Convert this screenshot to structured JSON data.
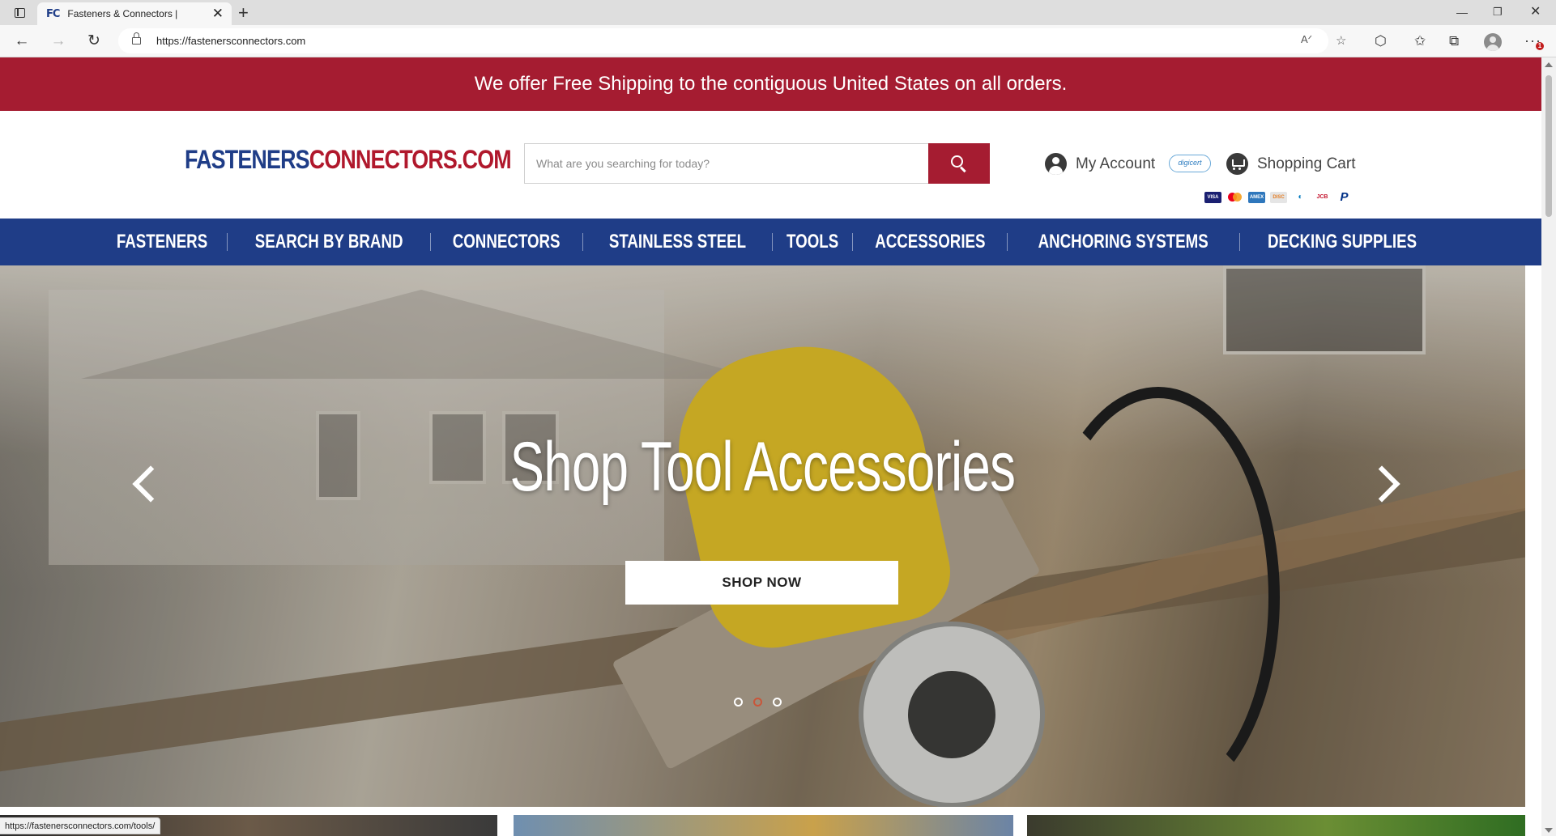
{
  "browser": {
    "tab_title": "Fasteners & Connectors |",
    "favicon_text": "FC",
    "url": "https://fastenersconnectors.com",
    "status_url": "https://fastenersconnectors.com/tools/",
    "notification_count": "1",
    "icons": {
      "back": "arrow-left-icon",
      "forward": "arrow-right-icon",
      "reload": "reload-icon",
      "read_aloud": "read-aloud-icon",
      "favorite": "favorite-add-icon",
      "extensions": "extensions-icon",
      "favorites": "favorites-icon",
      "collections": "collections-icon",
      "profile": "profile-icon",
      "more": "more-icon"
    }
  },
  "promo": {
    "text": "We offer Free Shipping to the contiguous United States on all orders."
  },
  "header": {
    "logo_part1": "FASTENERS",
    "logo_part2": "CONNECTORS.COM",
    "search_placeholder": "What are you searching for today?",
    "account_label": "My Account",
    "digicert_label": "digicert",
    "cart_label": "Shopping Cart",
    "payment_methods": [
      "VISA",
      "Mastercard",
      "AMEX",
      "Discover",
      "Diners Club",
      "JCB",
      "PayPal"
    ]
  },
  "nav": {
    "items": [
      "FASTENERS",
      "SEARCH BY BRAND",
      "CONNECTORS",
      "STAINLESS STEEL",
      "TOOLS",
      "ACCESSORIES",
      "ANCHORING SYSTEMS",
      "DECKING SUPPLIES"
    ]
  },
  "hero": {
    "title": "Shop Tool Accessories",
    "cta": "SHOP NOW",
    "slide_count": 3,
    "active_slide": 2
  },
  "colors": {
    "brand_red": "#a51c31",
    "brand_blue": "#1f3d87"
  }
}
